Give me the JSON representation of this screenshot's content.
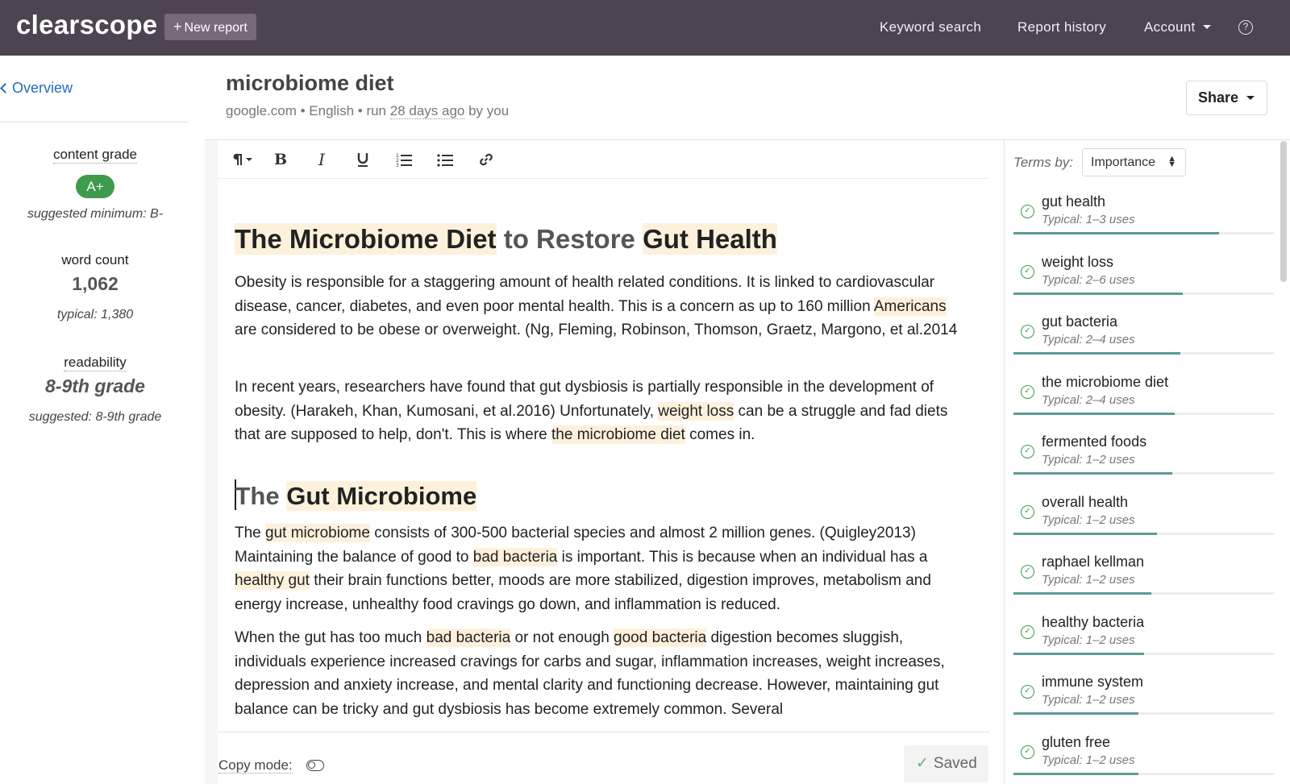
{
  "topbar": {
    "brand": "clearscope",
    "new_report_label": "New report",
    "new_report_icon": "plus-icon",
    "nav": [
      "Keyword search",
      "Report history",
      "Account"
    ],
    "help_icon": "question-circle-icon",
    "bg_color": "#4e4350"
  },
  "sidebar": {
    "overview_label": "Overview",
    "content_grade_label": "content grade",
    "content_grade_value": "A+",
    "content_grade_hint": "suggested minimum: B-",
    "word_count_label": "word count",
    "word_count_value": "1,062",
    "word_count_hint": "typical: 1,380",
    "readability_label": "readability",
    "readability_value": "8-9th grade",
    "readability_hint": "suggested: 8-9th grade",
    "grade_color": "#3e9a4c"
  },
  "header": {
    "title": "microbiome diet",
    "meta_prefix": "google.com • English • run ",
    "meta_time": "28 days ago",
    "meta_suffix": " by you",
    "share_label": "Share"
  },
  "toolbar": {
    "buttons": [
      "paragraph-icon",
      "bold-icon",
      "italic-icon",
      "underline-icon",
      "ordered-list-icon",
      "bullet-list-icon",
      "link-icon"
    ]
  },
  "document": {
    "h1": {
      "part1": "The Microbiome Diet",
      "part2": " to Restore ",
      "part3": "Gut Health"
    },
    "p1": {
      "a": "Obesity is responsible for a staggering amount of health related conditions. It is linked to cardiovascular disease, cancer, diabetes, and even poor mental health. This is a concern as up to 160 million ",
      "hl1": "Americans",
      "b": " are considered to be obese or overweight. (Ng, Fleming, Robinson, Thomson, Graetz, Margono, et al.2014"
    },
    "p2": {
      "a": "In recent years, researchers have found that gut dysbiosis is partially responsible in the development of obesity. (Harakeh, Khan, Kumosani, et al.2016) Unfortunately, ",
      "hl1": "weight loss",
      "b": " can be a struggle and fad diets that are supposed to help, don't. This is where ",
      "hl2": "the microbiome diet",
      "c": " comes in."
    },
    "h2": {
      "part1": "The ",
      "part2": "Gut Microbiome"
    },
    "p3": {
      "a": "The ",
      "hl1": "gut microbiome",
      "b": " consists of 300-500 bacterial species and almost 2 million genes. (Quigley2013) Maintaining the balance of good to ",
      "hl2": "bad bacteria",
      "c": " is important. This is because when an individual has a ",
      "hl3": "healthy gut",
      "d": " their brain functions better, moods are more stabilized, digestion improves, metabolism and energy increase, unhealthy food cravings go down, and inflammation is reduced."
    },
    "p4": {
      "a": "When the gut has too much ",
      "hl1": "bad bacteria",
      "b": " or not enough ",
      "hl2": "good bacteria",
      "c": " digestion becomes sluggish, individuals experience increased cravings for carbs and sugar, inflammation increases, weight increases, depression and anxiety increase, and mental clarity and functioning decrease. However, maintaining gut balance can be tricky and gut dysbiosis has become extremely common. Several"
    },
    "highlight_color": "#fdf1dc"
  },
  "footer": {
    "copy_mode_label": "Copy mode:",
    "saved_label": "Saved"
  },
  "terms": {
    "label": "Terms by:",
    "sort_value": "Importance",
    "progress_color": "#5b9c96",
    "items": [
      {
        "name": "gut health",
        "typical": "Typical: 1–3 uses",
        "progress": 0.79
      },
      {
        "name": "weight loss",
        "typical": "Typical: 2–6 uses",
        "progress": 0.65
      },
      {
        "name": "gut bacteria",
        "typical": "Typical: 2–4 uses",
        "progress": 0.64
      },
      {
        "name": "the microbiome diet",
        "typical": "Typical: 2–4 uses",
        "progress": 0.62
      },
      {
        "name": "fermented foods",
        "typical": "Typical: 1–2 uses",
        "progress": 0.61
      },
      {
        "name": "overall health",
        "typical": "Typical: 1–2 uses",
        "progress": 0.55
      },
      {
        "name": "raphael kellman",
        "typical": "Typical: 1–2 uses",
        "progress": 0.53
      },
      {
        "name": "healthy bacteria",
        "typical": "Typical: 1–2 uses",
        "progress": 0.5
      },
      {
        "name": "immune system",
        "typical": "Typical: 1–2 uses",
        "progress": 0.48
      },
      {
        "name": "gluten free",
        "typical": "Typical: 1–2 uses",
        "progress": 0.48
      }
    ]
  }
}
